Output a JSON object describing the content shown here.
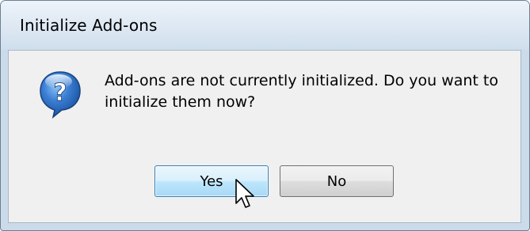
{
  "window": {
    "title": "Initialize Add-ons"
  },
  "dialog": {
    "icon": "question-icon",
    "message": "Add-ons are not currently initialized. Do you want to initialize them now?",
    "buttons": {
      "yes_label": "Yes",
      "no_label": "No"
    },
    "focused_button": "Yes"
  },
  "colors": {
    "accent_button": "#3c7fb1",
    "icon_blue": "#2a64b8",
    "title_bg": "#dde8f3",
    "client_bg": "#f0f0f0"
  },
  "cursor": "arrow-pointer-icon"
}
